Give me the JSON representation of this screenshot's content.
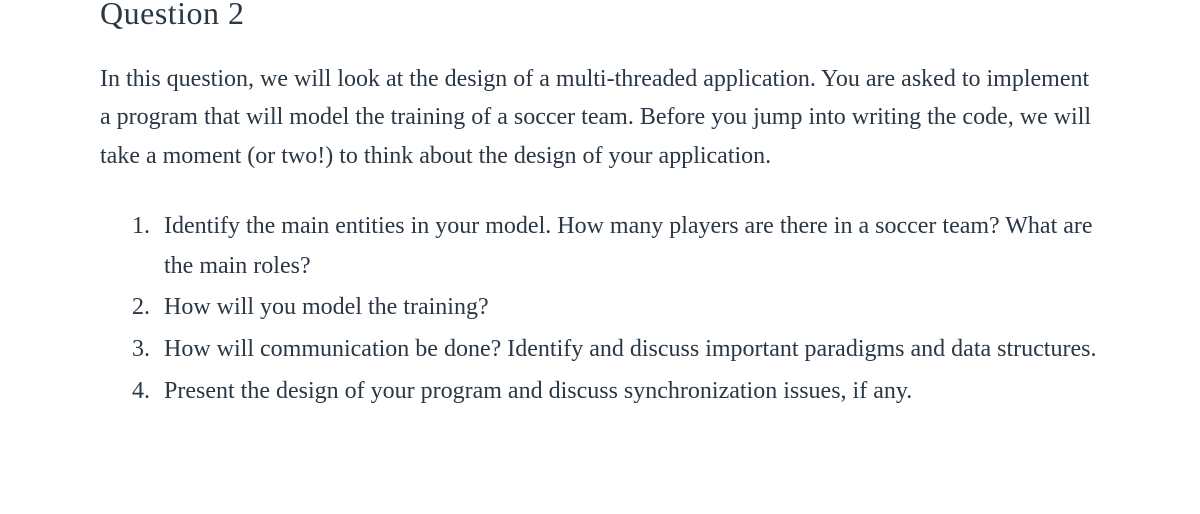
{
  "title": "Question 2",
  "intro": "In this question, we will look at the design of a multi-threaded application. You are asked to implement a program that will model the training of a soccer team. Before you jump into writing the code, we will take a moment (or two!) to think about the design of your application.",
  "items": [
    "Identify the main entities in your model. How many players are there in a soccer team? What are the main roles?",
    "How will you model the training?",
    "How will communication be done? Identify and discuss important paradigms and data structures.",
    "Present the design of your program and discuss synchronization issues, if any."
  ]
}
